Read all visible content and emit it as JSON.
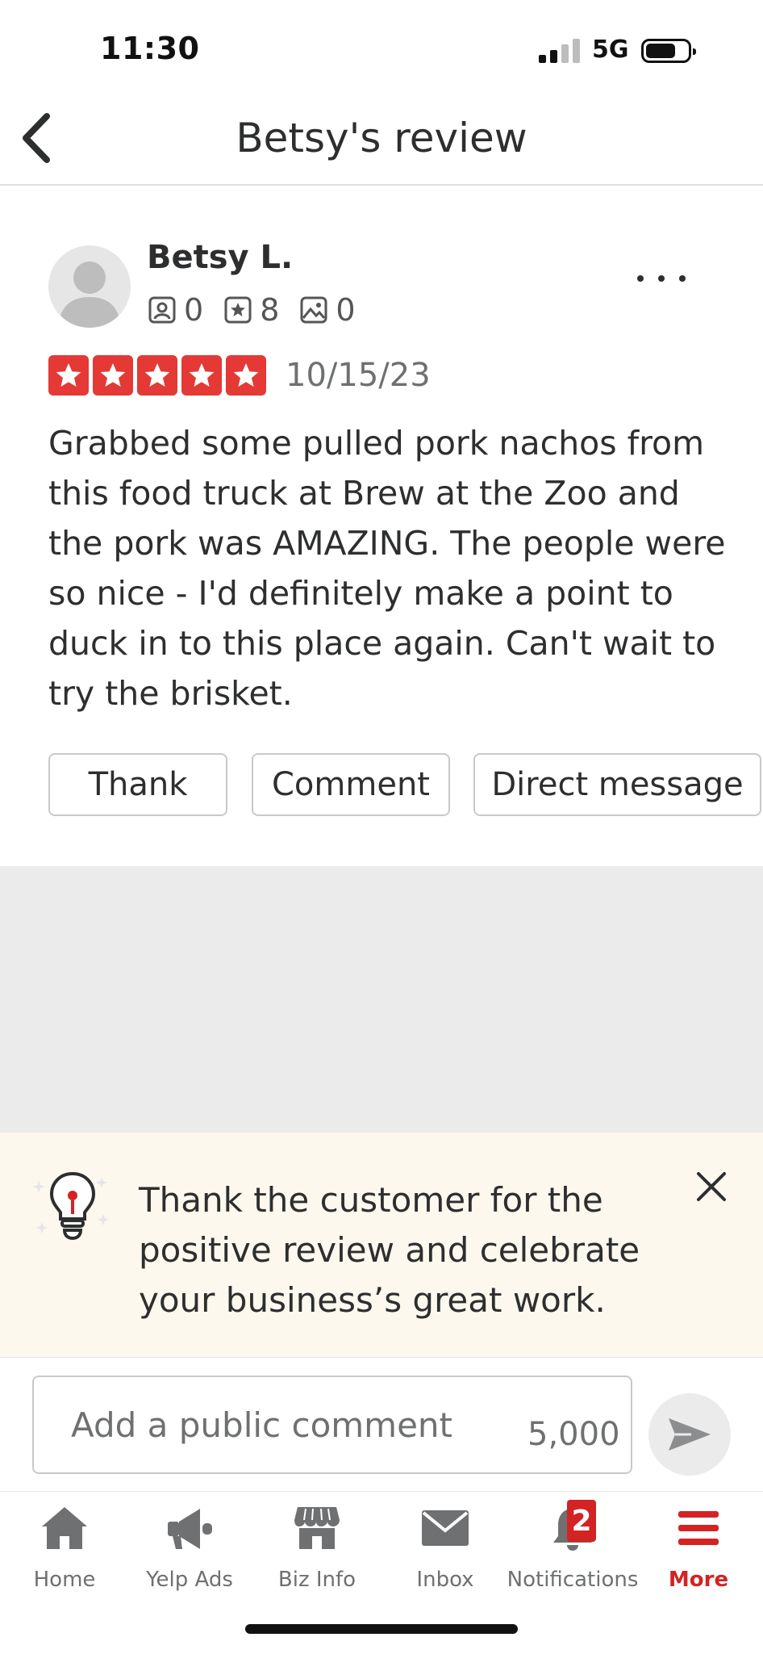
{
  "status_bar": {
    "time": "11:30",
    "network": "5G"
  },
  "header": {
    "title": "Betsy's review"
  },
  "reviewer": {
    "name": "Betsy L.",
    "friends_count": "0",
    "reviews_count": "8",
    "photos_count": "0"
  },
  "review": {
    "rating": 5,
    "rating_max": 5,
    "date": "10/15/23",
    "text": "Grabbed some pulled pork nachos from this food truck at Brew at the Zoo and the pork was AMAZING. The people were so nice - I'd definitely make a point to duck in to this place again. Can't wait to try the brisket."
  },
  "actions": {
    "thank": "Thank",
    "comment": "Comment",
    "direct_message": "Direct message"
  },
  "tip": {
    "text": "Thank the customer for the positive review and celebrate your business’s great work."
  },
  "comment_box": {
    "placeholder": "Add a public comment",
    "char_limit": "5,000"
  },
  "tabs": {
    "home": "Home",
    "yelp_ads": "Yelp Ads",
    "biz_info": "Biz Info",
    "inbox": "Inbox",
    "notifications": "Notifications",
    "notifications_badge": "2",
    "more": "More"
  },
  "colors": {
    "accent_red": "#d32323",
    "star_red": "#e53935",
    "tip_background": "#fcf8ed",
    "icon_gray": "#6e7072"
  }
}
